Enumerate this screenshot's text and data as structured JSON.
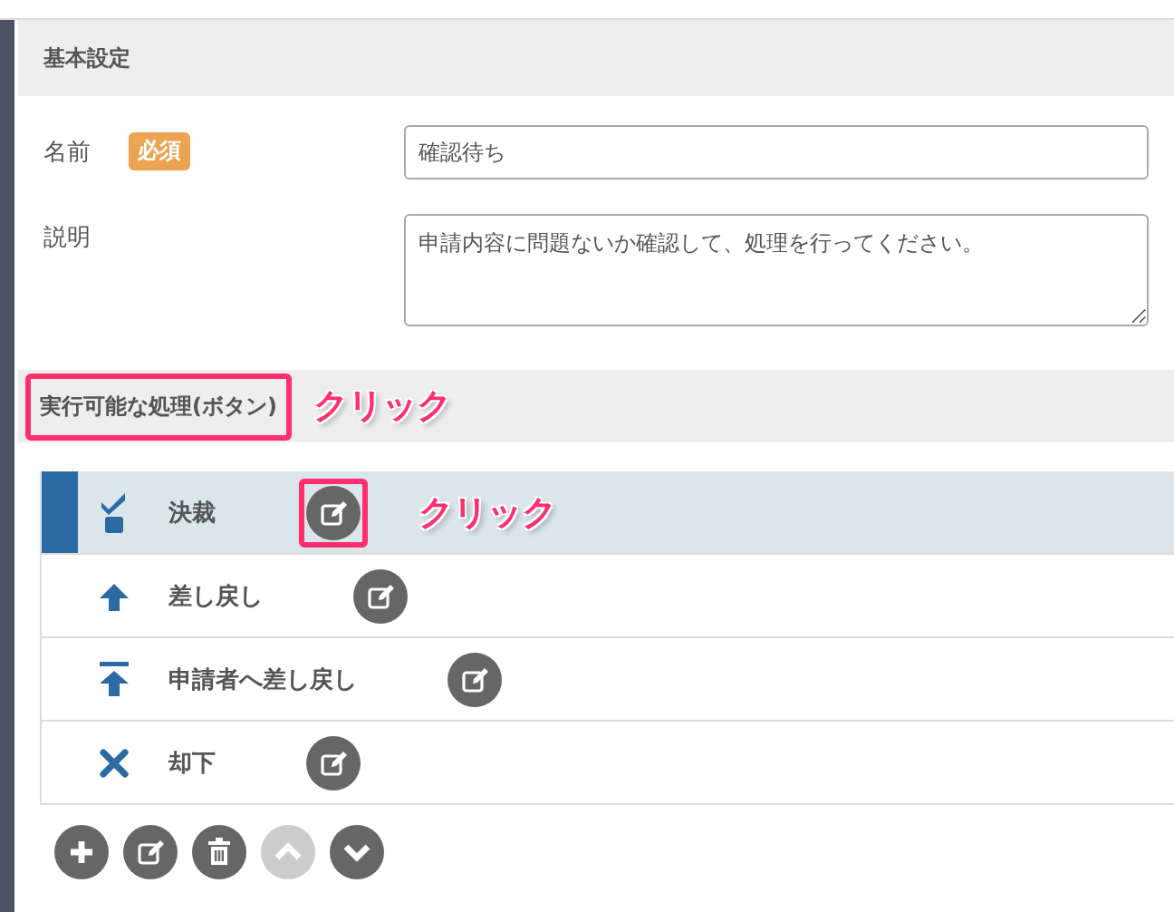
{
  "basic_settings": {
    "title": "基本設定",
    "fields": [
      {
        "kind": "input",
        "label": "名前",
        "badge": "必須",
        "value": "確認待ち"
      },
      {
        "kind": "textarea",
        "label": "説明",
        "value": "申請内容に問題ないか確認して、処理を行ってください。"
      }
    ]
  },
  "actions_section": {
    "title": "実行可能な処理(ボタン)",
    "highlighted": true,
    "callout": "クリック"
  },
  "actions": [
    {
      "kind": "approve",
      "label": "決裁",
      "selected": true,
      "edit_highlighted": true,
      "callout": "クリック"
    },
    {
      "kind": "return",
      "label": "差し戻し",
      "selected": false,
      "edit_highlighted": false
    },
    {
      "kind": "return_to_applicant",
      "label": "申請者へ差し戻し",
      "selected": false,
      "edit_highlighted": false
    },
    {
      "kind": "reject",
      "label": "却下",
      "selected": false,
      "edit_highlighted": false
    }
  ],
  "toolbar": [
    {
      "kind": "add",
      "disabled": false
    },
    {
      "kind": "edit",
      "disabled": false
    },
    {
      "kind": "delete",
      "disabled": false
    },
    {
      "kind": "up",
      "disabled": true
    },
    {
      "kind": "down",
      "disabled": false
    }
  ]
}
